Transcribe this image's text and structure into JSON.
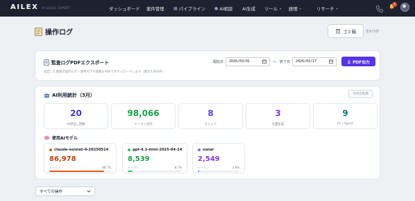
{
  "nav": {
    "brand_name": "AILEX",
    "brand_sub": "AI LEGAL EXPERT",
    "items": [
      {
        "label": "ダッシュボード",
        "icon": "",
        "caret": false
      },
      {
        "label": "案件管理",
        "icon": "",
        "caret": false
      },
      {
        "label": "パイプライン",
        "icon": "chart-icon",
        "caret": false
      },
      {
        "label": "AI相談",
        "icon": "chat-icon",
        "caret": false
      },
      {
        "label": "AI生成",
        "icon": "",
        "caret": false
      },
      {
        "label": "ツール",
        "icon": "",
        "caret": true
      },
      {
        "label": "経理",
        "icon": "",
        "caret": true
      },
      {
        "label": "リサーチ",
        "icon": "",
        "caret": true
      }
    ],
    "notification_count": "2"
  },
  "page": {
    "title": "操作ログ",
    "trash_label": "ゴミ箱",
    "total_label": "全975件"
  },
  "audit": {
    "title": "監査ログPDFエクスポート",
    "description": "指定した期間の操作ログ・使用モデル情報をPDFでダウンロードします（最大5,000件）",
    "start_label": "開始日",
    "start_date": "2026/03/01",
    "end_label": "終了日",
    "end_date": "2026/03/17",
    "tilde": "〜",
    "pdf_button": "PDF出力"
  },
  "ai_stats": {
    "title": "AI利用統計（3月）",
    "month_button": "今月の利用",
    "stats": [
      {
        "value": "20",
        "label": "AI呼出し回数",
        "color": "#4338ca"
      },
      {
        "value": "98,066",
        "label": "トークン合計",
        "color": "#16a34a"
      },
      {
        "value": "8",
        "label": "チャット",
        "color": "#4f46e5"
      },
      {
        "value": "3",
        "label": "文書生成",
        "color": "#7c3aed"
      },
      {
        "value": "9",
        "label": "FC / Agent",
        "color": "#0f766e"
      }
    ],
    "models_title": "使用AIモデル",
    "models": [
      {
        "name": "claude-sonnet-4-20250514",
        "value": "86,978",
        "token_label": "トークン",
        "pct": "88.7%",
        "fraction": 0.887,
        "color": "#c2410c",
        "dot": "#ea580c"
      },
      {
        "name": "gpt-4.1-mini-2025-04-14",
        "value": "8,539",
        "token_label": "トークン",
        "pct": "8.7%",
        "fraction": 0.087,
        "color": "#16a34a",
        "dot": "#22c55e"
      },
      {
        "name": "sonar",
        "value": "2,549",
        "token_label": "トークン",
        "pct": "2.6%",
        "fraction": 0.026,
        "color": "#7c3aed",
        "dot": "#8b5cf6"
      }
    ]
  },
  "filter": {
    "selected": "すべての操作"
  }
}
